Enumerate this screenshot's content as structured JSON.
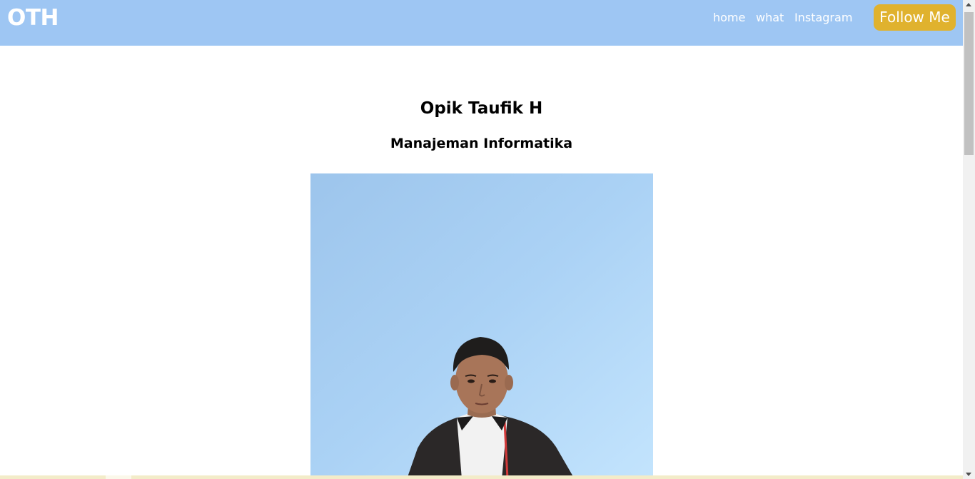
{
  "navbar": {
    "brand": "OTH",
    "links": [
      {
        "label": "home"
      },
      {
        "label": "what"
      },
      {
        "label": "Instagram"
      }
    ],
    "follow_label": "Follow Me",
    "background_color": "#9ec6f3",
    "button_color": "#e0b22e"
  },
  "profile": {
    "name": "Opik Taufik H",
    "major": "Manajeman Informatika",
    "photo_icon": "portrait-photo"
  }
}
